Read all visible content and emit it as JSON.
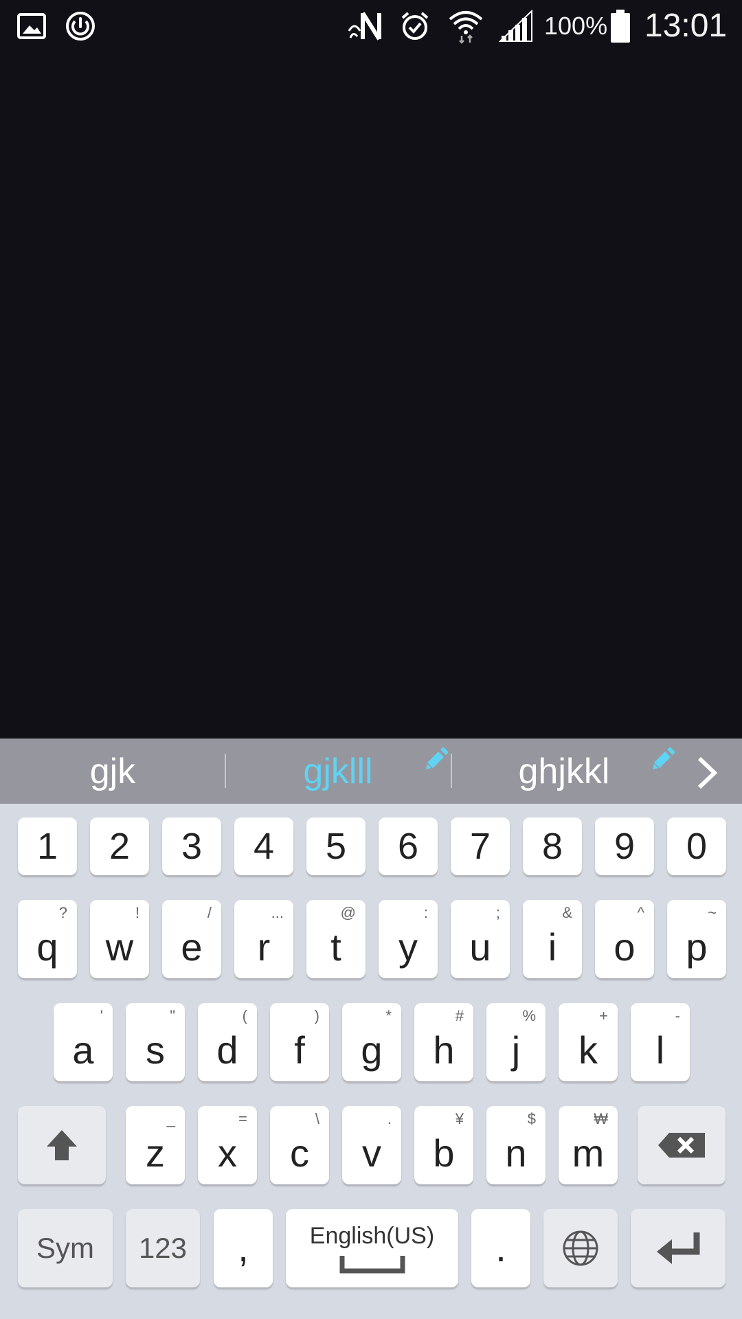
{
  "status_bar": {
    "battery_percent": "100%",
    "time": "13:01",
    "icons": [
      "gallery-icon",
      "sync-icon",
      "nfc-icon",
      "alarm-icon",
      "wifi-icon",
      "signal-icon",
      "battery-icon"
    ]
  },
  "suggestions": {
    "items": [
      "gjk",
      "gjklll",
      "ghjkkl"
    ],
    "active_index": 1,
    "active_color": "#5fd3f3"
  },
  "keyboard": {
    "number_row": [
      "1",
      "2",
      "3",
      "4",
      "5",
      "6",
      "7",
      "8",
      "9",
      "0"
    ],
    "row1": [
      {
        "key": "q",
        "sec": "?"
      },
      {
        "key": "w",
        "sec": "!"
      },
      {
        "key": "e",
        "sec": "/"
      },
      {
        "key": "r",
        "sec": "..."
      },
      {
        "key": "t",
        "sec": "@"
      },
      {
        "key": "y",
        "sec": ":"
      },
      {
        "key": "u",
        "sec": ";"
      },
      {
        "key": "i",
        "sec": "&"
      },
      {
        "key": "o",
        "sec": "^"
      },
      {
        "key": "p",
        "sec": "~"
      }
    ],
    "row2": [
      {
        "key": "a",
        "sec": "'"
      },
      {
        "key": "s",
        "sec": "\""
      },
      {
        "key": "d",
        "sec": "("
      },
      {
        "key": "f",
        "sec": ")"
      },
      {
        "key": "g",
        "sec": "*"
      },
      {
        "key": "h",
        "sec": "#"
      },
      {
        "key": "j",
        "sec": "%"
      },
      {
        "key": "k",
        "sec": "+"
      },
      {
        "key": "l",
        "sec": "-"
      }
    ],
    "row3": [
      {
        "key": "z",
        "sec": "_"
      },
      {
        "key": "x",
        "sec": "="
      },
      {
        "key": "c",
        "sec": "\\"
      },
      {
        "key": "v",
        "sec": "."
      },
      {
        "key": "b",
        "sec": "¥"
      },
      {
        "key": "n",
        "sec": "$"
      },
      {
        "key": "m",
        "sec": "₩"
      }
    ],
    "bottom": {
      "sym": "Sym",
      "num": "123",
      "comma": ",",
      "space": "English(US)",
      "period": "."
    }
  }
}
